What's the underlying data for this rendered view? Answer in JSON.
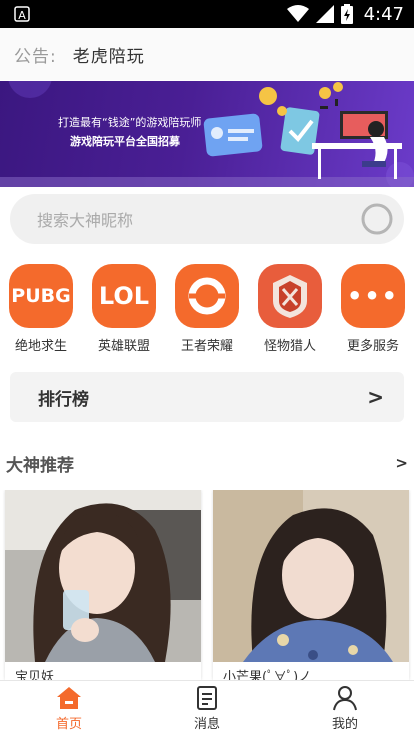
{
  "status_bar": {
    "time": "4:47",
    "app_icon": "a-letter-icon",
    "icons": [
      "wifi-icon",
      "signal-icon",
      "battery-icon"
    ]
  },
  "notice": {
    "label": "公告:",
    "text": "老虎陪玩"
  },
  "banner": {
    "line1": "打造最有“钱途”的游戏陪玩师",
    "line2": "游戏陪玩平台全国招募"
  },
  "search": {
    "placeholder": "搜索大神昵称"
  },
  "games": [
    {
      "label": "绝地求生",
      "icon_text": "PUBG",
      "icon": "pubg-icon"
    },
    {
      "label": "英雄联盟",
      "icon_text": "LOL",
      "icon": "lol-icon"
    },
    {
      "label": "王者荣耀",
      "icon_text": "",
      "icon": "honor-of-kings-icon"
    },
    {
      "label": "怪物猎人",
      "icon_text": "",
      "icon": "monster-hunter-icon"
    },
    {
      "label": "更多服务",
      "icon_text": "•••",
      "icon": "more-icon"
    }
  ],
  "ranking": {
    "title": "排行榜",
    "arrow": ">"
  },
  "recommend": {
    "title": "大神推荐",
    "arrow": ">"
  },
  "cards": [
    {
      "name": "宝贝妖"
    },
    {
      "name": "小芒果(ﾟ∀ﾟ)ノ"
    }
  ],
  "tabs": [
    {
      "label": "首页",
      "icon": "home-icon",
      "active": true
    },
    {
      "label": "消息",
      "icon": "message-icon",
      "active": false
    },
    {
      "label": "我的",
      "icon": "profile-icon",
      "active": false
    }
  ],
  "colors": {
    "accent": "#f46a2c",
    "banner": "#4a1f95"
  }
}
